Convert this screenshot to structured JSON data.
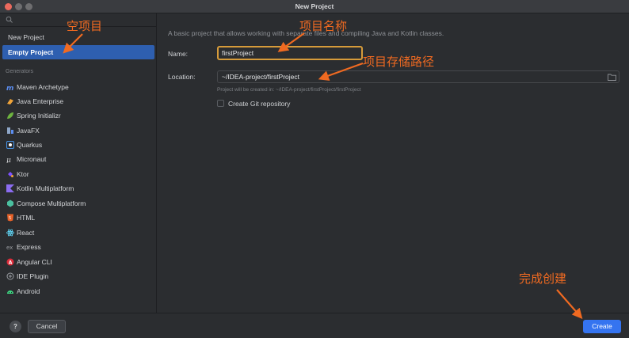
{
  "window": {
    "title": "New Project"
  },
  "sidebar": {
    "items": [
      {
        "label": "New Project",
        "selected": false
      },
      {
        "label": "Empty Project",
        "selected": true
      }
    ],
    "generators_label": "Generators",
    "generators": [
      {
        "label": "Maven Archetype",
        "icon": "maven-icon"
      },
      {
        "label": "Java Enterprise",
        "icon": "java-enterprise-icon"
      },
      {
        "label": "Spring Initializr",
        "icon": "spring-icon"
      },
      {
        "label": "JavaFX",
        "icon": "javafx-icon"
      },
      {
        "label": "Quarkus",
        "icon": "quarkus-icon"
      },
      {
        "label": "Micronaut",
        "icon": "micronaut-icon"
      },
      {
        "label": "Ktor",
        "icon": "ktor-icon"
      },
      {
        "label": "Kotlin Multiplatform",
        "icon": "kotlin-icon"
      },
      {
        "label": "Compose Multiplatform",
        "icon": "compose-icon"
      },
      {
        "label": "HTML",
        "icon": "html-icon"
      },
      {
        "label": "React",
        "icon": "react-icon"
      },
      {
        "label": "Express",
        "icon": "express-icon"
      },
      {
        "label": "Angular CLI",
        "icon": "angular-icon"
      },
      {
        "label": "IDE Plugin",
        "icon": "ide-plugin-icon"
      },
      {
        "label": "Android",
        "icon": "android-icon"
      }
    ]
  },
  "main": {
    "description": "A basic project that allows working with separate files and compiling Java and Kotlin classes.",
    "name_label": "Name:",
    "name_value": "firstProject",
    "location_label": "Location:",
    "location_value": "~/IDEA-project/firstProject",
    "location_hint": "Project will be created in: ~/IDEA-project/firstProject/firstProject",
    "git_label": "Create Git repository",
    "git_checked": false
  },
  "footer": {
    "help_label": "?",
    "cancel_label": "Cancel",
    "create_label": "Create"
  },
  "annotations": {
    "empty_project": "空项目",
    "project_name": "项目名称",
    "project_path": "项目存储路径",
    "finish_create": "完成创建"
  },
  "colors": {
    "accent": "#2e5fb0",
    "primary_button": "#3574f0",
    "focus_border": "#d69b3a",
    "annotation": "#f06a21"
  }
}
